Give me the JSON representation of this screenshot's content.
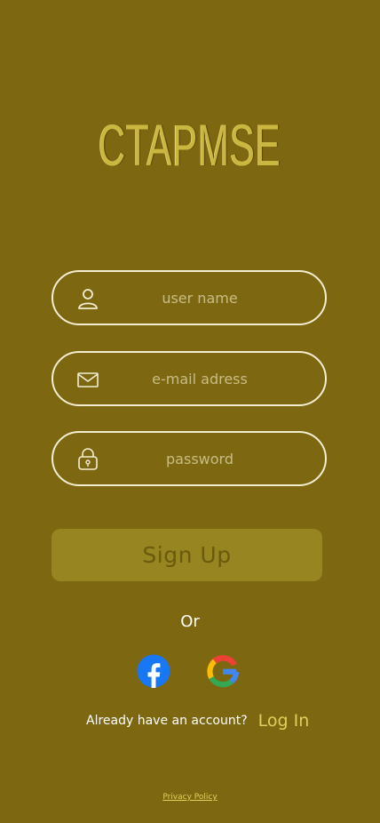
{
  "app": {
    "logo_text": "CTAPMSE"
  },
  "form": {
    "username": {
      "placeholder": "user name",
      "value": "",
      "icon": "user-icon"
    },
    "email": {
      "placeholder": "e-mail adress",
      "value": "",
      "icon": "mail-icon"
    },
    "password": {
      "placeholder": "password",
      "value": "",
      "icon": "lock-icon"
    }
  },
  "signup_button": {
    "label": "Sign Up"
  },
  "or_label": "Or",
  "social": [
    {
      "name": "facebook",
      "icon": "facebook-icon"
    },
    {
      "name": "google",
      "icon": "google-icon"
    }
  ],
  "login": {
    "prompt": "Already have an account?",
    "link_label": "Log In"
  },
  "footer": {
    "privacy_label": "Privacy Policy"
  },
  "colors": {
    "background": "#7d6710",
    "field_border": "#f3eed2",
    "button_fill": "#968520",
    "button_text": "#6b5a0c",
    "accent": "#e3cf5d"
  }
}
